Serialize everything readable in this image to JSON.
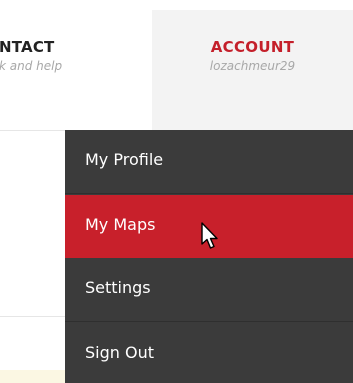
{
  "nav": {
    "contact": {
      "title": "NTACT",
      "subtitle": "k and help"
    },
    "account": {
      "title": "ACCOUNT",
      "username": "lozachmeur29"
    }
  },
  "dropdown": {
    "items": [
      {
        "label": "My Profile",
        "active": false
      },
      {
        "label": "My Maps",
        "active": true
      },
      {
        "label": "Settings",
        "active": false
      },
      {
        "label": "Sign Out",
        "active": false
      }
    ]
  },
  "colors": {
    "accent_red": "#c8202b",
    "account_red": "#c41f2a",
    "menu_bg": "#3b3b3b",
    "account_tab_bg": "#f3f3f3"
  },
  "icons": {
    "cursor": "mouse-pointer-icon"
  }
}
